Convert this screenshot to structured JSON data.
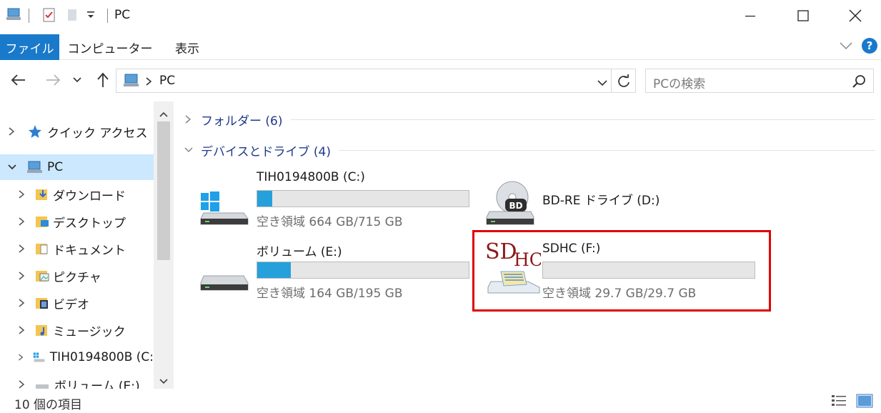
{
  "window": {
    "title": "PC",
    "minimize_label": "—",
    "maximize_label": "☐",
    "close_label": "✕"
  },
  "ribbon": {
    "tabs": [
      {
        "label": "ファイル"
      },
      {
        "label": "コンピューター"
      },
      {
        "label": "表示"
      }
    ]
  },
  "address": {
    "path": "PC",
    "search_placeholder": "PCの検索"
  },
  "nav": {
    "items": [
      {
        "label": "クイック アクセス"
      },
      {
        "label": "PC"
      },
      {
        "label": "ダウンロード"
      },
      {
        "label": "デスクトップ"
      },
      {
        "label": "ドキュメント"
      },
      {
        "label": "ピクチャ"
      },
      {
        "label": "ビデオ"
      },
      {
        "label": "ミュージック"
      },
      {
        "label": "TIH0194800B (C:"
      },
      {
        "label": "ボリューム (E:)"
      }
    ]
  },
  "content": {
    "groups": [
      {
        "label": "フォルダー (6)"
      },
      {
        "label": "デバイスとドライブ (4)"
      }
    ],
    "drives": [
      {
        "name": "TIH0194800B (C:)",
        "free": "空き領域 664 GB/715 GB",
        "used_fraction": 0.07
      },
      {
        "name": "BD-RE ドライブ (D:)",
        "icon_label": "BD"
      },
      {
        "name": "ボリューム (E:)",
        "free": "空き領域 164 GB/195 GB",
        "used_fraction": 0.16
      },
      {
        "name": "SDHC (F:)",
        "free": "空き領域 29.7 GB/29.7 GB",
        "used_fraction": 0.0,
        "logo_text_main": "SD",
        "logo_text_sub": "HC"
      }
    ]
  },
  "status": {
    "item_count": "10 個の項目"
  },
  "colors": {
    "accent": "#1979ca",
    "bar_fill": "#26a0da",
    "highlight": "#e00000",
    "nav_selected": "#cce8ff"
  }
}
